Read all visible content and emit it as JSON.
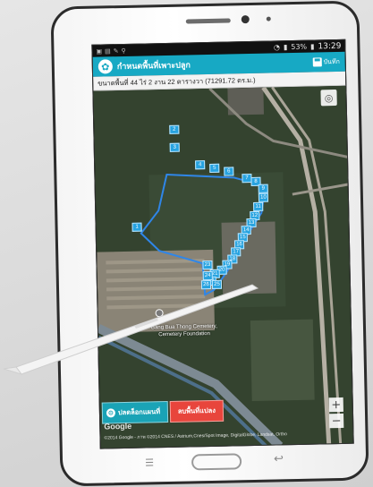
{
  "status_bar": {
    "battery": "53%",
    "time": "13:29"
  },
  "app_bar": {
    "title": "กำหนดพื้นที่เพาะปลูก",
    "save_label": "บันทึก"
  },
  "area_info": "ขนาดพื้นที่ 44 ไร่ 2 งาน 22 ตารางวา (71291.72 ตร.ม.)",
  "map": {
    "place_label": "Bang Bua Thong Cemetery, Cemetery Foundation",
    "google_logo": "Google",
    "attribution": "©2014 Google - ภาพ ©2014 CNES / Astrium,Cnes/Spot Image, DigitalGlobe, Landsat, Ortho",
    "markers": [
      "2",
      "3",
      "4",
      "5",
      "6",
      "7",
      "8",
      "9",
      "10",
      "11",
      "12",
      "13",
      "14",
      "15",
      "16",
      "17",
      "18",
      "19",
      "20",
      "21",
      "22",
      "23",
      "24",
      "25",
      "1",
      "26"
    ],
    "polygon_color": "#2f86e8"
  },
  "buttons": {
    "unlock": "ปลดล็อกแผนที่",
    "delete": "ลบพื้นที่แปลง"
  },
  "colors": {
    "app_bar": "#17a9c4",
    "unlock_button": "#1aa3b6",
    "delete_button": "#e8453c",
    "marker": "#27a3e0"
  }
}
